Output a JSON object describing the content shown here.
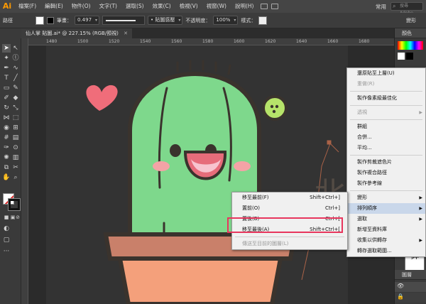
{
  "app": {
    "logo": "Ai"
  },
  "menubar": {
    "items": [
      "檔案(F)",
      "編輯(E)",
      "物件(O)",
      "文字(T)",
      "選取(S)",
      "效果(C)",
      "檢視(V)",
      "視窗(W)",
      "說明(H)"
    ],
    "workspace": "常用",
    "search_placeholder": "搜尋 Adobe"
  },
  "controlbar": {
    "selection_label": "路徑",
    "stroke_label": "筆畫：",
    "stroke_value": "0.497",
    "brush_value": "• 貼圖感壓",
    "opacity_label": "不透明度：",
    "opacity_value": "100%",
    "style_label": "樣式：",
    "transform_label": "變形",
    "colors": {
      "fill": "#ffffff",
      "stroke": "#000000"
    }
  },
  "document": {
    "tab_label": "仙人掌 貼圖.ai* @ 227.15% (RGB/預視)"
  },
  "ruler": {
    "ticks": [
      "1480",
      "1500",
      "1520",
      "1540",
      "1560",
      "1580",
      "1600",
      "1620",
      "1640",
      "1660",
      "1680"
    ]
  },
  "rightpanel": {
    "tab_color": "顏色",
    "tab_layers": "圖層",
    "preview_text": "北鼻"
  },
  "artwork": {
    "text": "北鼻",
    "colors": {
      "cactus": "#7ed88c",
      "outline": "#3a332d",
      "pot": "#f4a07b",
      "heart": "#f06d7a",
      "flower": "#b6e36a"
    }
  },
  "context_menu_main": {
    "items": [
      {
        "label": "還原貼至上層(U)",
        "shortcut": "",
        "submenu": false,
        "disabled": false,
        "highlight": false,
        "sep_after": false
      },
      {
        "label": "重做(R)",
        "shortcut": "",
        "submenu": false,
        "disabled": true,
        "highlight": false,
        "sep_after": true
      },
      {
        "label": "製作像素級最佳化",
        "shortcut": "",
        "submenu": false,
        "disabled": false,
        "highlight": false,
        "sep_after": true
      },
      {
        "label": "透視",
        "shortcut": "",
        "submenu": true,
        "disabled": true,
        "highlight": false,
        "sep_after": true
      },
      {
        "label": "群組",
        "shortcut": "",
        "submenu": false,
        "disabled": false,
        "highlight": false,
        "sep_after": false
      },
      {
        "label": "合併...",
        "shortcut": "",
        "submenu": false,
        "disabled": false,
        "highlight": false,
        "sep_after": false
      },
      {
        "label": "平均...",
        "shortcut": "",
        "submenu": false,
        "disabled": false,
        "highlight": false,
        "sep_after": true
      },
      {
        "label": "製作剪裁遮色片",
        "shortcut": "",
        "submenu": false,
        "disabled": false,
        "highlight": false,
        "sep_after": false
      },
      {
        "label": "製作複合路徑",
        "shortcut": "",
        "submenu": false,
        "disabled": false,
        "highlight": false,
        "sep_after": false
      },
      {
        "label": "製作參考線",
        "shortcut": "",
        "submenu": false,
        "disabled": false,
        "highlight": false,
        "sep_after": true
      },
      {
        "label": "變形",
        "shortcut": "",
        "submenu": true,
        "disabled": false,
        "highlight": false,
        "sep_after": false
      },
      {
        "label": "排列順序",
        "shortcut": "",
        "submenu": true,
        "disabled": false,
        "highlight": true,
        "sep_after": false
      },
      {
        "label": "選取",
        "shortcut": "",
        "submenu": true,
        "disabled": false,
        "highlight": false,
        "sep_after": false
      },
      {
        "label": "新增至資料庫",
        "shortcut": "",
        "submenu": false,
        "disabled": false,
        "highlight": false,
        "sep_after": false
      },
      {
        "label": "收集以供轉存",
        "shortcut": "",
        "submenu": true,
        "disabled": false,
        "highlight": false,
        "sep_after": false
      },
      {
        "label": "轉存選取範圍...",
        "shortcut": "",
        "submenu": false,
        "disabled": false,
        "highlight": false,
        "sep_after": false
      }
    ]
  },
  "context_menu_arrange": {
    "items": [
      {
        "label": "移至最前(F)",
        "shortcut": "Shift+Ctrl+]",
        "submenu": false,
        "disabled": false,
        "highlight": false,
        "sep_after": false
      },
      {
        "label": "置前(O)",
        "shortcut": "Ctrl+]",
        "submenu": false,
        "disabled": false,
        "highlight": false,
        "sep_after": false
      },
      {
        "label": "置後(B)",
        "shortcut": "Ctrl+[",
        "submenu": false,
        "disabled": false,
        "highlight": false,
        "sep_after": false
      },
      {
        "label": "移至最後(A)",
        "shortcut": "Shift+Ctrl+[",
        "submenu": false,
        "disabled": false,
        "highlight": false,
        "sep_after": true
      },
      {
        "label": "傳送至目前的圖層(L)",
        "shortcut": "",
        "submenu": false,
        "disabled": true,
        "highlight": false,
        "sep_after": false
      }
    ]
  }
}
